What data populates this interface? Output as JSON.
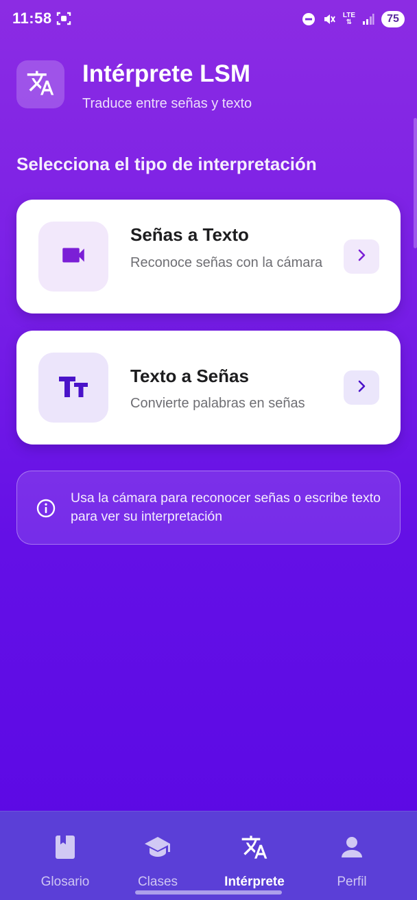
{
  "status_bar": {
    "time": "11:58",
    "network": "LTE",
    "battery": "75"
  },
  "header": {
    "title": "Intérprete LSM",
    "subtitle": "Traduce entre señas y texto"
  },
  "section_title": "Selecciona el tipo de interpretación",
  "cards": [
    {
      "title": "Señas a Texto",
      "description": "Reconoce señas con la cámara",
      "icon": "video-camera-icon"
    },
    {
      "title": "Texto a Señas",
      "description": "Convierte palabras en señas",
      "icon": "text-size-icon"
    }
  ],
  "info": {
    "text": "Usa la cámara para reconocer señas o escribe texto para ver su interpretación",
    "icon": "info-icon"
  },
  "bottom_nav": {
    "items": [
      {
        "label": "Glosario",
        "icon": "book-icon",
        "active": false
      },
      {
        "label": "Clases",
        "icon": "graduation-cap-icon",
        "active": false
      },
      {
        "label": "Intérprete",
        "icon": "translate-icon",
        "active": true
      },
      {
        "label": "Perfil",
        "icon": "person-icon",
        "active": false
      }
    ]
  },
  "colors": {
    "accent": "#7b1fd6",
    "card_title": "#1d1d1f",
    "card_description": "#6e6e73",
    "nav_background": "#5b3fd7"
  }
}
